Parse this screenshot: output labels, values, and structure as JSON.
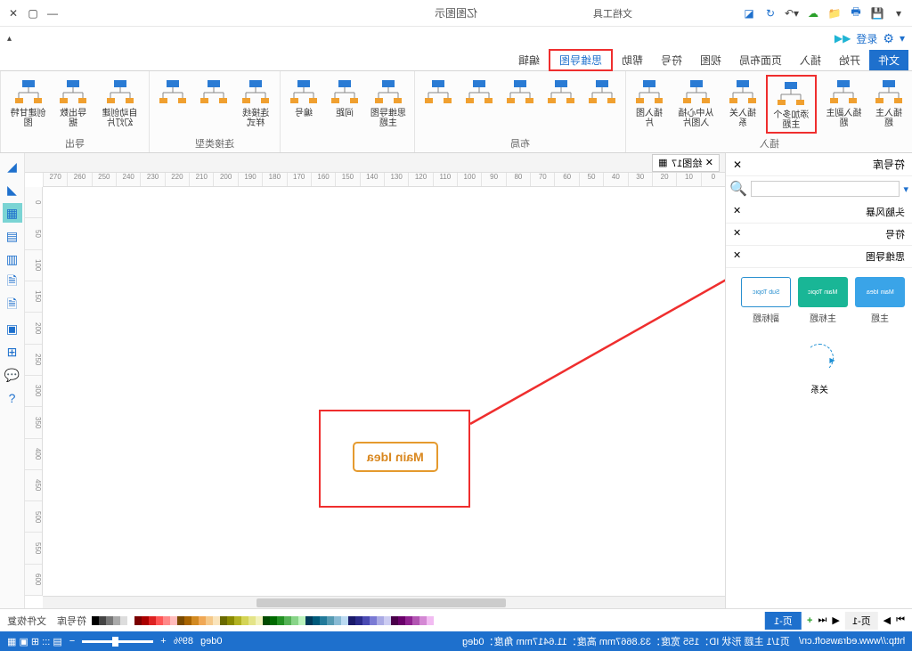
{
  "titlebar": {
    "title": "亿图图示",
    "context_tab": "文档工具"
  },
  "qat": {
    "login": "登录"
  },
  "tabs": [
    "文件",
    "开始",
    "插入",
    "页面布局",
    "视图",
    "符号",
    "帮助",
    "思维导图",
    "编辑"
  ],
  "tabs_highlight_index": 7,
  "tabs_active_index": 0,
  "ribbon": {
    "groups": [
      {
        "label": "插入",
        "items": [
          {
            "label": "插入主题",
            "icon": "mindmap"
          },
          {
            "label": "插入副主题",
            "icon": "mindmap"
          },
          {
            "label": "添加多个主题",
            "icon": "mindmap",
            "boxed": true
          },
          {
            "label": "插入关系",
            "icon": "link"
          },
          {
            "label": "从中心插入图片",
            "icon": "pic"
          },
          {
            "label": "插入图片",
            "icon": "pic"
          }
        ]
      },
      {
        "label": "布局",
        "items": [
          {
            "label": "",
            "icon": "layout1"
          },
          {
            "label": "",
            "icon": "layout2"
          },
          {
            "label": "",
            "icon": "layout3"
          },
          {
            "label": "",
            "icon": "layout4"
          },
          {
            "label": "",
            "icon": "layout5"
          }
        ]
      },
      {
        "label": "",
        "items": [
          {
            "label": "思维导图主题",
            "icon": "theme"
          },
          {
            "label": "间距",
            "icon": "spacing"
          },
          {
            "label": "编号",
            "icon": "number"
          }
        ]
      },
      {
        "label": "连接类型",
        "items": [
          {
            "label": "连接线样式",
            "icon": "conn"
          },
          {
            "label": "",
            "icon": "conn2"
          },
          {
            "label": "",
            "icon": "conn3"
          }
        ]
      },
      {
        "label": "导出",
        "items": [
          {
            "label": "自动创建幻灯片",
            "icon": "slides"
          },
          {
            "label": "导出数据",
            "icon": "export"
          },
          {
            "label": "创建甘特图",
            "icon": "gantt"
          }
        ]
      }
    ]
  },
  "side": {
    "title": "符号库",
    "sections": [
      "头脑风暴",
      "符号",
      "思维导图"
    ],
    "thumbs": [
      {
        "label": "主题",
        "img_label": "Main Idea",
        "color": "#3aa4e8"
      },
      {
        "label": "主标题",
        "img_label": "Main Topic",
        "color": "#19b696"
      },
      {
        "label": "副标题",
        "img_label": "Sub Topic",
        "color": "#ffffff",
        "text": "#2a90d0",
        "border": "#2a90d0"
      }
    ],
    "relation_label": "关系"
  },
  "doc_tab": "绘图17",
  "ruler_values": [
    "0",
    "10",
    "20",
    "30",
    "40",
    "50",
    "60",
    "70",
    "80",
    "90",
    "100",
    "110",
    "120",
    "130",
    "140",
    "150",
    "160",
    "170",
    "180",
    "190",
    "200",
    "210",
    "220",
    "230",
    "240",
    "250",
    "260",
    "270"
  ],
  "ruler_v_values": [
    "0",
    "50",
    "100",
    "150",
    "200",
    "250",
    "300",
    "350",
    "400",
    "450",
    "500",
    "550",
    "600"
  ],
  "main_idea_text": "Main Idea",
  "page_tabs": {
    "primary": "页-1",
    "secondary": "页-1"
  },
  "status": {
    "url": "http://www.edrawsoft.cn/",
    "info": "页1/1  主题  形状 ID：155  宽度：33.8667mm  高度：11.6417mm  角度：0deg",
    "zoom": "89%"
  },
  "left_tools": [
    "◢",
    "◣",
    "▦",
    "▤",
    "▥",
    "🗎",
    "🗎",
    "▣",
    "⊞",
    "💬",
    "?"
  ],
  "colors": [
    "#000",
    "#444",
    "#777",
    "#aaa",
    "#ddd",
    "#fff",
    "#7a0000",
    "#a00",
    "#d22",
    "#f55",
    "#f88",
    "#fbb",
    "#7a4a00",
    "#a86400",
    "#d28a22",
    "#f0a855",
    "#f5c888",
    "#fae4bb",
    "#6a6a00",
    "#8a8a00",
    "#b2b222",
    "#d4d455",
    "#e4e488",
    "#f2f2bb",
    "#004a00",
    "#006a00",
    "#229022",
    "#55b255",
    "#88d488",
    "#bbf2bb",
    "#003a5a",
    "#005a7a",
    "#227a9a",
    "#559ab2",
    "#88bad4",
    "#bbdaf2",
    "#1a1a6a",
    "#2a2a8a",
    "#4a4ab2",
    "#7a7ad4",
    "#aaaae4",
    "#ccccf2",
    "#4a004a",
    "#6a006a",
    "#902290",
    "#b255b2",
    "#d488d4",
    "#f2bbf2"
  ]
}
